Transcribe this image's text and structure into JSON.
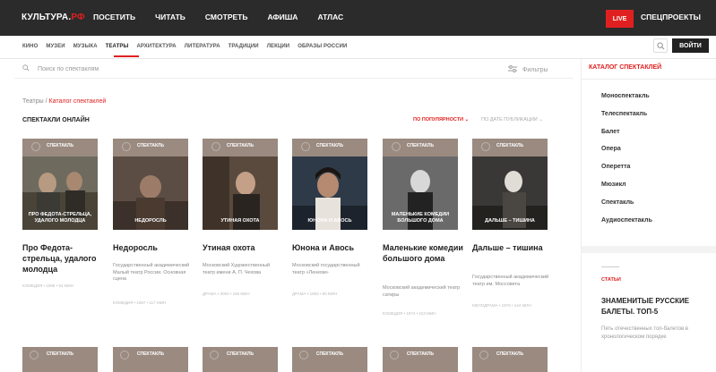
{
  "header": {
    "logo_main": "КУЛЬТУРА.",
    "logo_rf": "РФ",
    "nav": [
      "ПОСЕТИТЬ",
      "ЧИТАТЬ",
      "СМОТРЕТЬ",
      "АФИША",
      "АТЛАС"
    ],
    "live_label": "LIVE",
    "special_label": "СПЕЦПРОЕКТЫ"
  },
  "subnav": {
    "items": [
      "КИНО",
      "МУЗЕИ",
      "МУЗЫКА",
      "ТЕАТРЫ",
      "АРХИТЕКТУРА",
      "ЛИТЕРАТУРА",
      "ТРАДИЦИИ",
      "ЛЕКЦИИ",
      "ОБРАЗЫ РОССИИ"
    ],
    "active": "ТЕАТРЫ",
    "login_label": "ВОЙТИ"
  },
  "search": {
    "placeholder": "Поиск по спектаклям",
    "filters_label": "Фильтры"
  },
  "breadcrumb": {
    "root": "Театры",
    "sep": "/",
    "current": "Каталог спектаклей"
  },
  "main": {
    "section_title": "СПЕКТАКЛИ ОНЛАЙН",
    "sort_active": "ПО ПОПУЛЯРНОСТИ ⌄",
    "sort_other": "ПО ДАТЕ ПУБЛИКАЦИИ ⌄",
    "cards": [
      {
        "tag": "СПЕКТАКЛЬ",
        "caption": "ПРО ФЕДОТА-СТРЕЛЬЦА, УДАЛОГО МОЛОДЦА",
        "title": "Про Федота-стрельца, удалого молодца",
        "desc": "",
        "meta": "КОМЕДИЯ • 1988 • 54 МИН"
      },
      {
        "tag": "СПЕКТАКЛЬ",
        "caption": "НЕДОРОСЛЬ",
        "title": "Недоросль",
        "desc": "Государственный академический Малый театр России. Основная сцена",
        "meta": "КОМЕДИЯ • 1987 • 117 МИН"
      },
      {
        "tag": "СПЕКТАКЛЬ",
        "caption": "УТИНАЯ ОХОТА",
        "title": "Утиная охота",
        "desc": "Московский Художественный театр имени А. П. Чехова",
        "meta": "ДРАМА • 2004 • 186 МИН"
      },
      {
        "tag": "СПЕКТАКЛЬ",
        "caption": "ЮНОНА И АВОСЬ",
        "title": "Юнона и Авось",
        "desc": "Московский государственный театр «Ленком»",
        "meta": "ДРАМА • 1983 • 80 МИН"
      },
      {
        "tag": "СПЕКТАКЛЬ",
        "caption": "МАЛЕНЬКИЕ КОМЕДИИ БОЛЬШОГО ДОМА",
        "title": "Маленькие комедии большого дома",
        "desc": "Московский академический театр сатиры",
        "meta": "КОМЕДИЯ • 1974 • 153 МИН"
      },
      {
        "tag": "СПЕКТАКЛЬ",
        "caption": "ДАЛЬШЕ – ТИШИНА",
        "title": "Дальше – тишина",
        "desc": "Государственный академический театр им. Моссовета",
        "meta": "МЕЛОДРАМА • 1978 • 144 МИН"
      }
    ],
    "bottom_tags": [
      "СПЕКТАКЛЬ",
      "СПЕКТАКЛЬ",
      "СПЕКТАКЛЬ",
      "СПЕКТАКЛЬ",
      "СПЕКТАКЛЬ",
      "СПЕКТАКЛЬ"
    ]
  },
  "sidebar": {
    "heading": "КАТАЛОГ СПЕКТАКЛЕЙ",
    "items": [
      "Моноспектакль",
      "Телеспектакль",
      "Балет",
      "Опера",
      "Оперетта",
      "Мюзикл",
      "Спектакль",
      "Аудиоспектакль"
    ],
    "article_tag": "СТАТЬИ",
    "article_title": "ЗНАМЕНИТЫЕ РУССКИЕ БАЛЕТЫ. ТОП-5",
    "article_desc": "Пять отечественных топ-балетов в хронологическом порядке"
  },
  "colors": {
    "accent": "#e02020",
    "topbar": "#2b2b2b"
  }
}
